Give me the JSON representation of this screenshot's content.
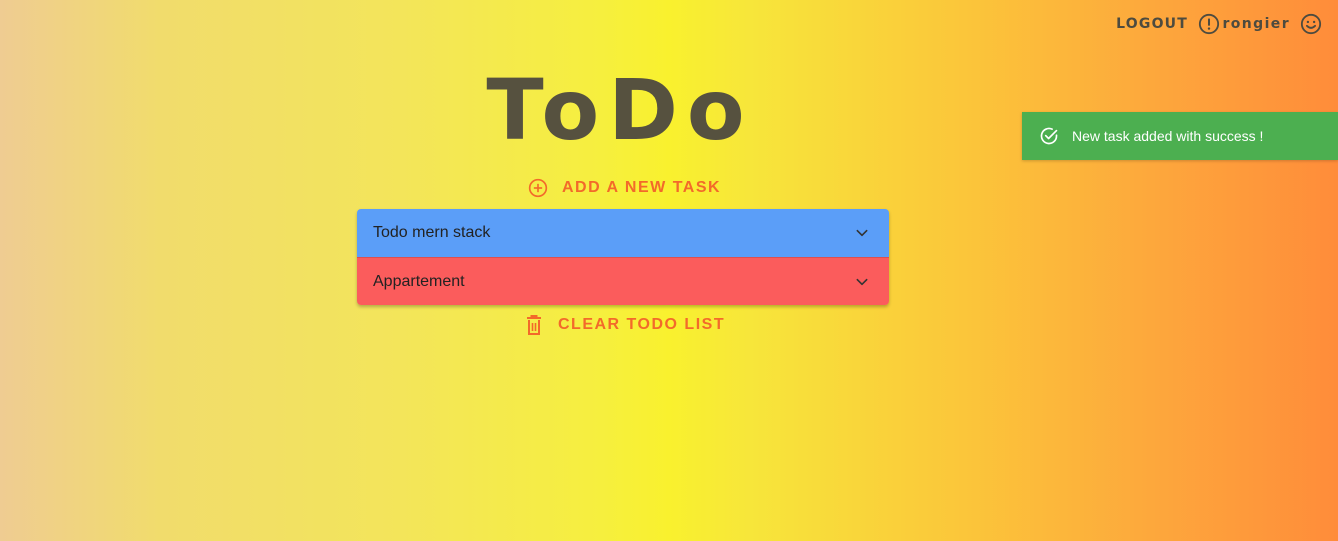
{
  "header": {
    "logout_label": "LOGOUT",
    "username": "rongier",
    "logout_icon": "alert-circle-icon",
    "user_icon": "smiley-face-icon"
  },
  "main": {
    "title": "ToDo",
    "add_task_label": "ADD A NEW TASK",
    "clear_list_label": "CLEAR TODO LIST",
    "todos": [
      {
        "label": "Todo mern stack",
        "color": "#5b9ef8"
      },
      {
        "label": "Appartement",
        "color": "#fb5c5c"
      }
    ]
  },
  "toast": {
    "message": "New task added with success !",
    "icon": "check-circle-icon",
    "color": "#4caf50"
  },
  "colors": {
    "accent": "#f36a2a",
    "text_dark": "#4d4b3f",
    "title": "#56513f"
  }
}
